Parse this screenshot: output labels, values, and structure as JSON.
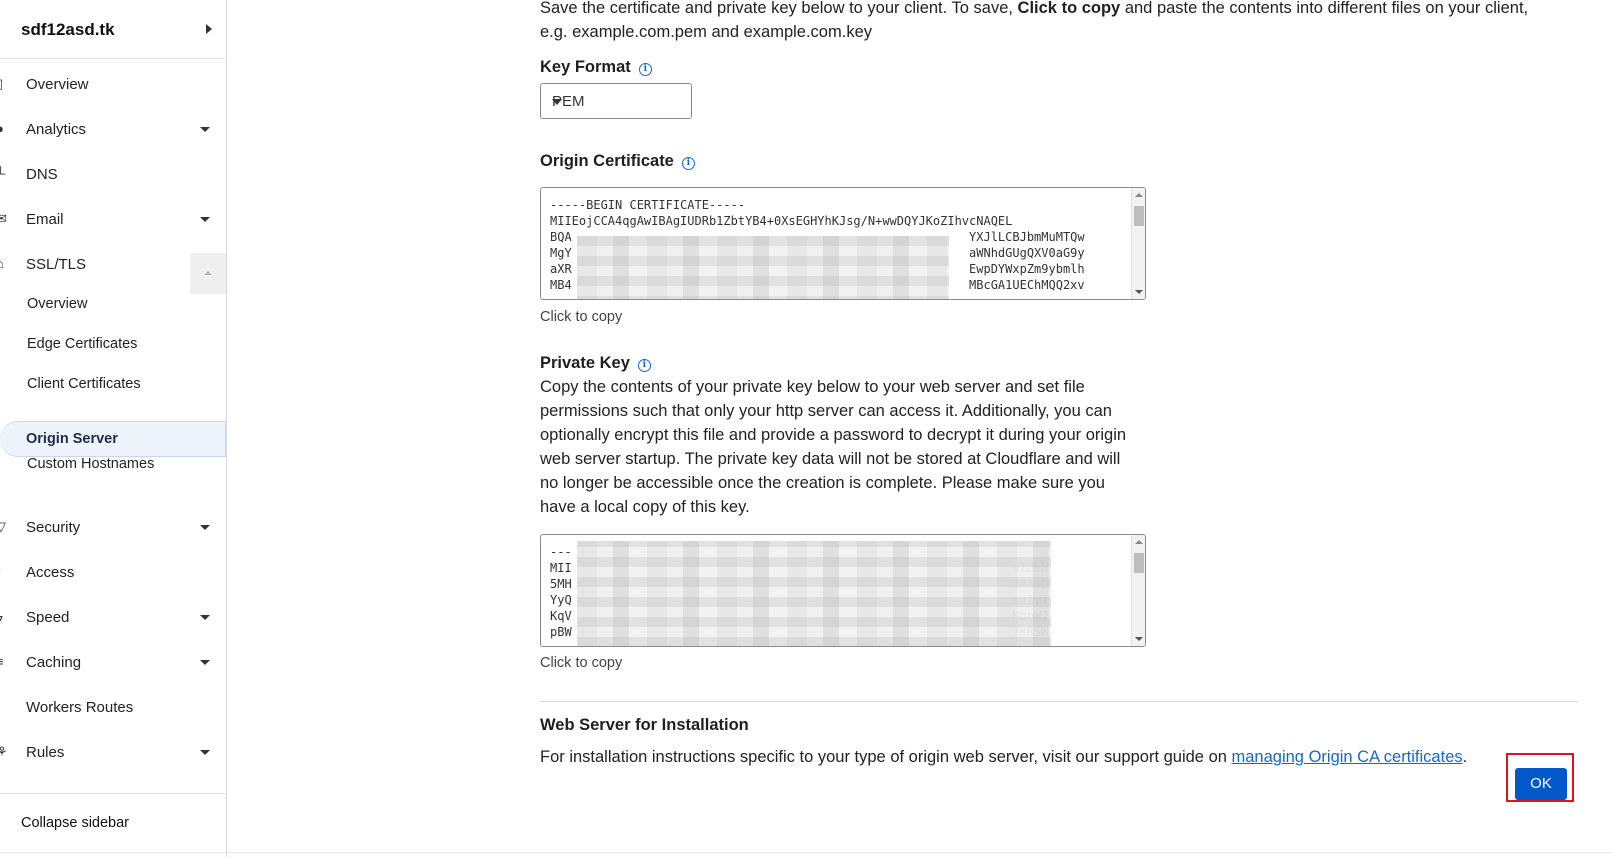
{
  "sidebar": {
    "domain": "sdf12asd.tk",
    "items": [
      {
        "label": "Overview",
        "icon": "document-icon",
        "has_caret": false
      },
      {
        "label": "Analytics",
        "icon": "globe-icon",
        "has_caret": true
      },
      {
        "label": "DNS",
        "icon": "network-icon",
        "has_caret": false
      },
      {
        "label": "Email",
        "icon": "envelope-icon",
        "has_caret": true
      },
      {
        "label": "SSL/TLS",
        "icon": "lock-icon",
        "has_caret": false,
        "expanded": true
      },
      {
        "label": "Security",
        "icon": "shield-icon",
        "has_caret": true
      },
      {
        "label": "Access",
        "icon": "access-icon",
        "has_caret": false
      },
      {
        "label": "Speed",
        "icon": "bolt-icon",
        "has_caret": true
      },
      {
        "label": "Caching",
        "icon": "server-icon",
        "has_caret": true
      },
      {
        "label": "Workers Routes",
        "icon": "workers-icon",
        "has_caret": false
      },
      {
        "label": "Rules",
        "icon": "rules-icon",
        "has_caret": true
      }
    ],
    "ssl_subitems": [
      {
        "label": "Overview"
      },
      {
        "label": "Edge Certificates"
      },
      {
        "label": "Client Certificates"
      },
      {
        "label": "Origin Server",
        "active": true
      },
      {
        "label": "Custom Hostnames"
      }
    ],
    "collapse_label": "Collapse sidebar"
  },
  "main": {
    "intro_part1": "Save the certificate and private key below to your client. To save, ",
    "intro_bold": "Click to copy",
    "intro_part2": " and paste the contents into different files on your client, e.g. example.com.pem and example.com.key",
    "key_format": {
      "title": "Key Format",
      "selected": "PEM"
    },
    "origin_certificate": {
      "title": "Origin Certificate",
      "lines": [
        "-----BEGIN CERTIFICATE-----",
        "MIIEojCCA4qgAwIBAgIUDRb1ZbtYB4+0XsEGHYhKJsg/N+wwDQYJKoZIhvcNAQEL",
        "BQA                                                       YXJlLCBJbmMuMTQw",
        "MgY                                                       aWNhdGUgQXV0aG9y",
        "aXR                                                       EwpDYWxpZm9ybmlh",
        "MB4                                                       MBcGA1UEChMQQ2xv"
      ],
      "copy_hint": "Click to copy"
    },
    "private_key": {
      "title": "Private Key",
      "description": "Copy the contents of your private key below to your web server and set file permissions such that only your http server can access it. Additionally, you can optionally encrypt this file and provide a password to decrypt it during your origin web server startup. The private key data will not be stored at Cloudflare and will no longer be accessible once the creation is complete. Please make sure you have a local copy of this key.",
      "lines": [
        "---",
        "MII                                                             ulUbN",
        "5MH                                                             2AAvD",
        "YyQ                                                             ovIy7",
        "KqV                                                             MbbWJ",
        "pBW                                                             7KRSW"
      ],
      "copy_hint": "Click to copy"
    },
    "web_server": {
      "title": "Web Server for Installation",
      "text": "For installation instructions specific to your type of origin web server, visit our support guide on ",
      "link": "managing Origin CA certificates",
      "suffix": "."
    },
    "ok_label": "OK"
  },
  "colors": {
    "accent": "#0058c9",
    "link": "#1668c7",
    "highlight_outline": "#e0141e",
    "active_nav_bg": "#eef4fb"
  }
}
